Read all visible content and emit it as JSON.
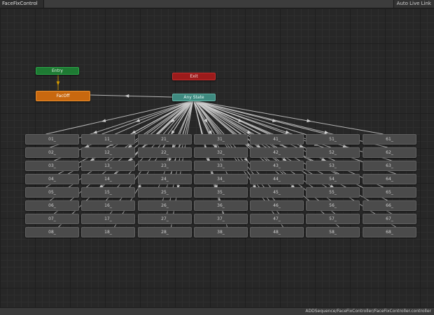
{
  "window": {
    "tab_title": "FaceFixControl",
    "auto_live_link": "Auto Live Link"
  },
  "status_bar": {
    "path": "ADDSequence/FaceFixController/FaceFixController.controller"
  },
  "nodes": {
    "entry": "Entry",
    "exit": "Exit",
    "default_state": "FacOff",
    "any_state": "Any State"
  },
  "states": [
    [
      "01_",
      "02_",
      "03_",
      "04_",
      "05_",
      "06_",
      "07_",
      "08_"
    ],
    [
      "11_",
      "12_",
      "13_",
      "14_",
      "15_",
      "16_",
      "17_",
      "18_"
    ],
    [
      "21_",
      "22_",
      "23_",
      "24_",
      "25_",
      "26_",
      "27_",
      "28_"
    ],
    [
      "31_",
      "32_",
      "33_",
      "34_",
      "35_",
      "36_",
      "37_",
      "38_"
    ],
    [
      "41_",
      "42_",
      "43_",
      "44_",
      "45_",
      "46_",
      "47_",
      "48_"
    ],
    [
      "51_",
      "52_",
      "53_",
      "54_",
      "55_",
      "56_",
      "57_",
      "58_"
    ],
    [
      "61_",
      "62_",
      "63_",
      "64_",
      "65_",
      "66_",
      "67_",
      "68_"
    ]
  ],
  "colors": {
    "entry": "#1e7a33",
    "exit": "#9c1b1b",
    "default_state": "#c8680f",
    "any_state": "#3f8a80",
    "state": "#4b4b4b",
    "transition": "#cfcfcf",
    "entry_transition": "#d49a00"
  }
}
